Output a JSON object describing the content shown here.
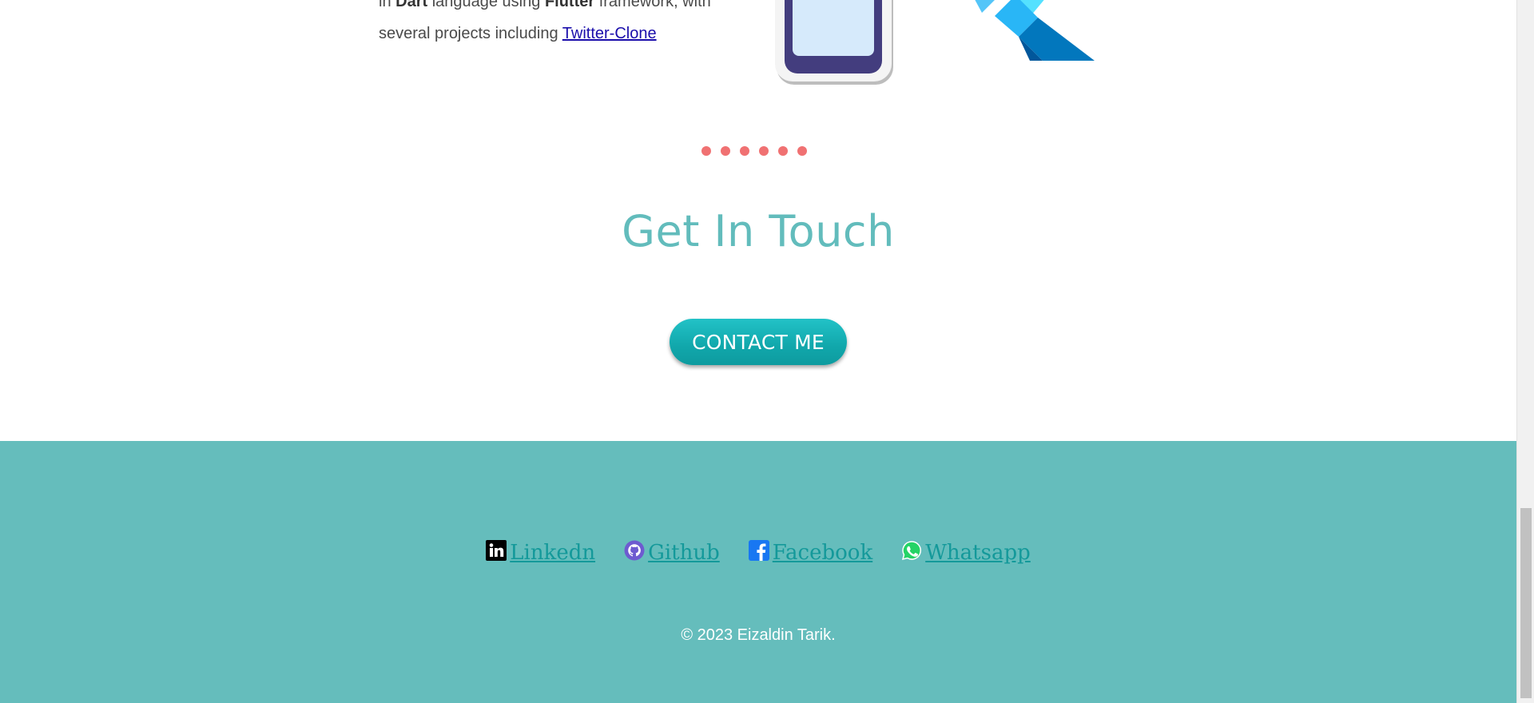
{
  "project": {
    "line1_prefix": "in ",
    "lang": "Dart",
    "line1_mid": " language using ",
    "framework": "Flutter",
    "line1_suffix": " framework, with",
    "line2_prefix": "several projects including ",
    "link_label": "Twitter-Clone"
  },
  "divider": {
    "dot_count": 6,
    "color": "#f07172"
  },
  "contact": {
    "title": "Get In Touch",
    "button_label": "CONTACT ME",
    "title_color": "#62bcbc"
  },
  "footer": {
    "bg_color": "#65bdbc",
    "links": [
      {
        "label": "Linkedn",
        "icon": "linkedin-icon"
      },
      {
        "label": "Github",
        "icon": "github-icon"
      },
      {
        "label": "Facebook",
        "icon": "facebook-icon"
      },
      {
        "label": "Whatsapp",
        "icon": "whatsapp-icon"
      }
    ],
    "copyright": "© 2023 Eizaldin Tarik."
  }
}
